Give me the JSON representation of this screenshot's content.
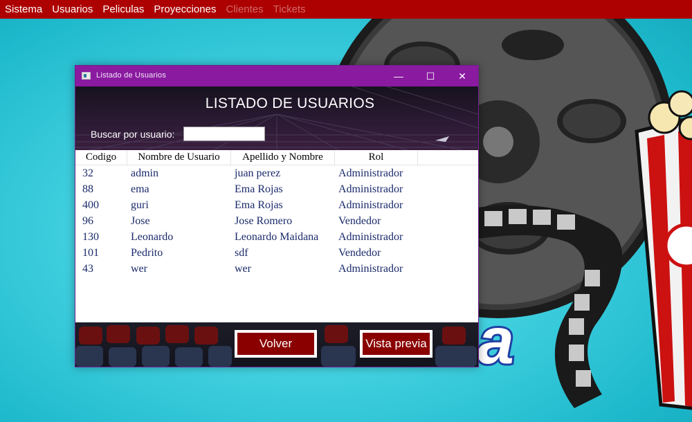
{
  "menu": {
    "items": [
      {
        "label": "Sistema",
        "enabled": true
      },
      {
        "label": "Usuarios",
        "enabled": true
      },
      {
        "label": "Peliculas",
        "enabled": true
      },
      {
        "label": "Proyecciones",
        "enabled": true
      },
      {
        "label": "Clientes",
        "enabled": false
      },
      {
        "label": "Tickets",
        "enabled": false
      }
    ]
  },
  "window": {
    "title": "Listado de Usuarios",
    "controls": {
      "minimize": "—",
      "maximize": "☐",
      "close": "✕"
    }
  },
  "header": {
    "title": "LISTADO DE USUARIOS",
    "search_label": "Buscar por usuario:",
    "search_value": ""
  },
  "table": {
    "columns": [
      "Codigo",
      "Nombre de Usuario",
      "Apellido y Nombre",
      "Rol"
    ],
    "rows": [
      {
        "codigo": "32",
        "usuario": "admin",
        "nombre": "juan perez",
        "rol": "Administrador"
      },
      {
        "codigo": "88",
        "usuario": "ema",
        "nombre": "Ema Rojas",
        "rol": "Administrador"
      },
      {
        "codigo": "400",
        "usuario": "guri",
        "nombre": "Ema Rojas",
        "rol": "Administrador"
      },
      {
        "codigo": "96",
        "usuario": "Jose",
        "nombre": "Jose Romero",
        "rol": "Vendedor"
      },
      {
        "codigo": "130",
        "usuario": "Leonardo",
        "nombre": "Leonardo Maidana",
        "rol": "Administrador"
      },
      {
        "codigo": "101",
        "usuario": "Pedrito",
        "nombre": "sdf",
        "rol": "Vendedor"
      },
      {
        "codigo": "43",
        "usuario": "wer",
        "nombre": "wer",
        "rol": "Administrador"
      }
    ]
  },
  "buttons": {
    "back": "Volver",
    "preview": "Vista previa"
  },
  "colors": {
    "menubar": "#ad0000",
    "titlebar": "#8a1aa0",
    "button": "#8a0000",
    "cell_text": "#1a2a6b"
  },
  "background": {
    "logo_fragment": "a"
  }
}
